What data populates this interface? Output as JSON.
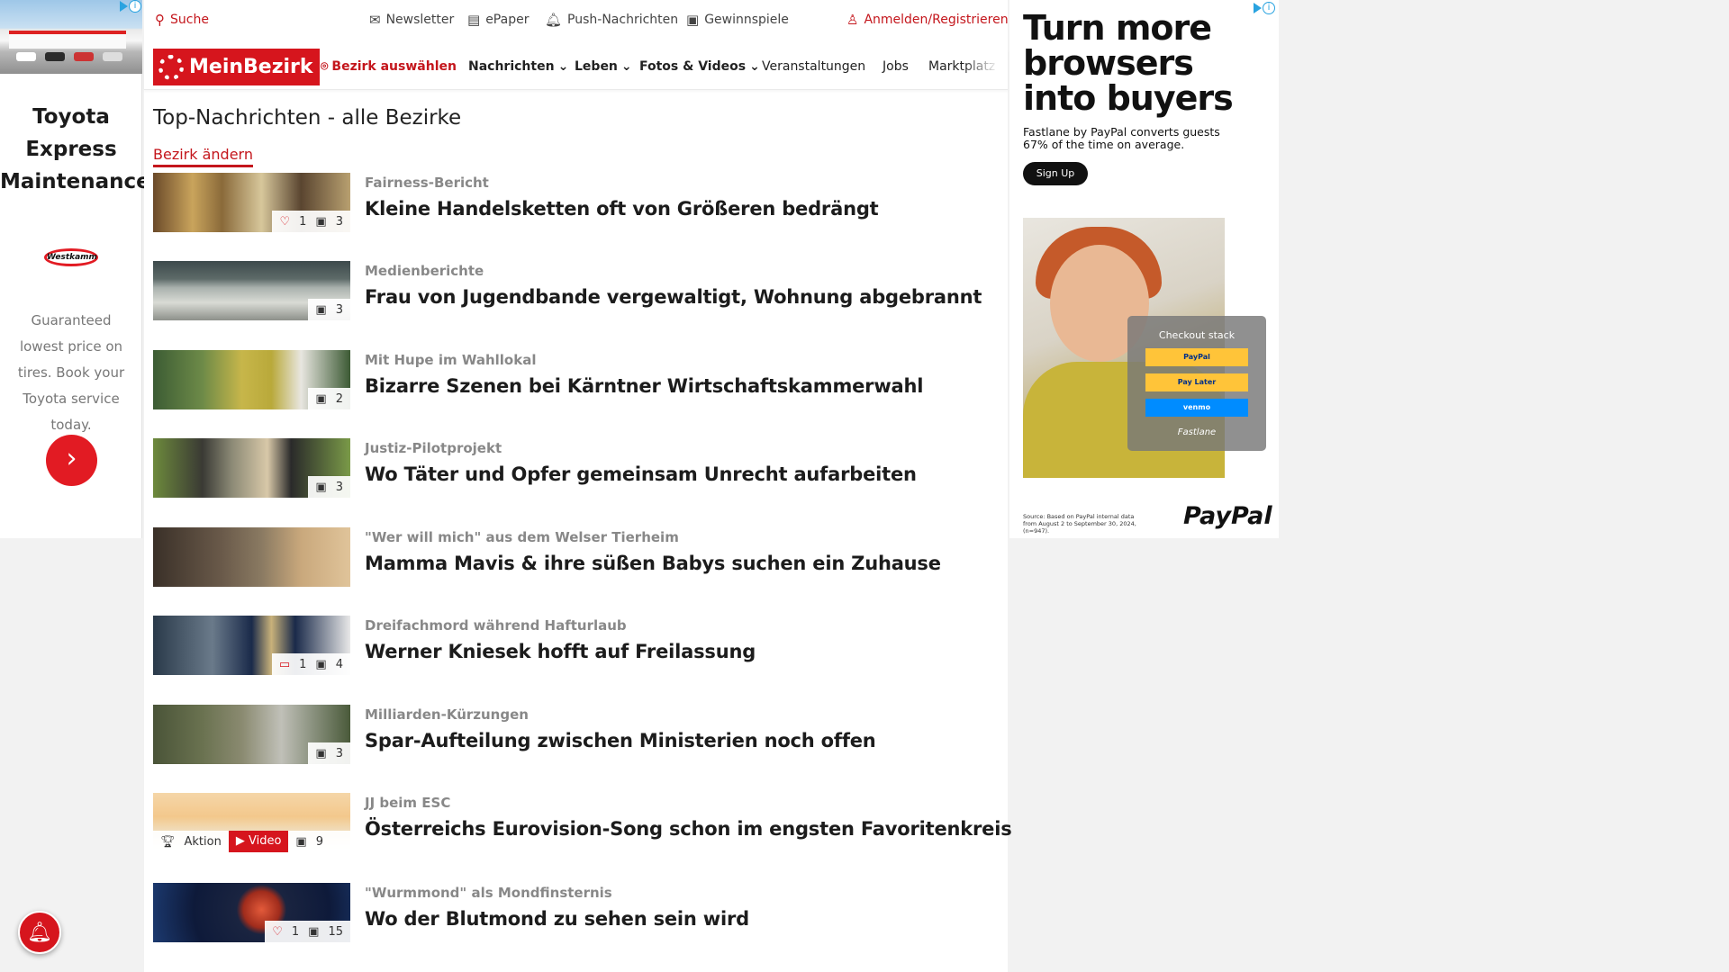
{
  "left_ad": {
    "title": "Toyota Express Maintenance",
    "logo_text": "Westkamm",
    "text": "Guaranteed lowest price on tires. Book your Toyota service today.",
    "cta_icon": "chevron-right-icon"
  },
  "topbar": {
    "search": "Suche",
    "newsletter": "Newsletter",
    "epaper": "ePaper",
    "push": "Push-Nachrichten",
    "games": "Gewinnspiele",
    "login": "Anmelden/Registrieren"
  },
  "nav": {
    "logo": "MeinBezirk",
    "district": "Bezirk auswählen",
    "news": "Nachrichten",
    "life": "Leben",
    "photos": "Fotos & Videos",
    "events": "Veranstaltungen",
    "jobs": "Jobs",
    "market": "Marktplatz"
  },
  "page": {
    "title": "Top-Nachrichten - alle Bezirke",
    "change_district": "Bezirk ändern"
  },
  "news": [
    {
      "kicker": "Fairness-Bericht",
      "headline": "Kleine Handelsketten oft von Größeren bedrängt",
      "likes": "1",
      "images": "3"
    },
    {
      "kicker": "Medienberichte",
      "headline": "Frau von Jugendbande vergewaltigt, Wohnung abgebrannt",
      "likes": "",
      "images": "3"
    },
    {
      "kicker": "Mit Hupe im Wahllokal",
      "headline": "Bizarre Szenen bei Kärntner Wirtschaftskammerwahl",
      "likes": "",
      "images": "2"
    },
    {
      "kicker": "Justiz-Pilotprojekt",
      "headline": "Wo Täter und Opfer gemeinsam Unrecht aufarbeiten",
      "likes": "",
      "images": "3"
    },
    {
      "kicker": "\"Wer will mich\" aus dem Welser Tierheim",
      "headline": "Mamma Mavis & ihre süßen Babys suchen ein Zuhause",
      "likes": "",
      "images": ""
    },
    {
      "kicker": "Dreifachmord während Hafturlaub",
      "headline": "Werner Kniesek hofft auf Freilassung",
      "comments": "1",
      "images": "4"
    },
    {
      "kicker": "Milliarden-Kürzungen",
      "headline": "Spar-Aufteilung zwischen Ministerien noch offen",
      "likes": "",
      "images": "3"
    },
    {
      "kicker": "JJ beim ESC",
      "headline": "Österreichs Eurovision-Song schon im engsten Favoritenkreis",
      "promo": "Aktion",
      "video": "Video",
      "images": "9"
    },
    {
      "kicker": "\"Wurmmond\" als Mondfinsternis",
      "headline": "Wo der Blutmond zu sehen sein wird",
      "likes": "1",
      "images": "15"
    }
  ],
  "right_ad": {
    "headline": "Turn more browsers into buyers",
    "sub": "Fastlane by PayPal converts guests 67% of the time on average.",
    "cta": "Sign Up",
    "checkout_title": "Checkout stack",
    "btn1": "PayPal",
    "btn2": "Pay Later",
    "btn3": "venmo",
    "fastlane": "Fastlane",
    "source": "Source: Based on PayPal internal data from August 2 to September 30, 2024, (n=947).",
    "brand": "PayPal"
  },
  "colors": {
    "brand_red": "#d6151d",
    "link_red": "#c4161c",
    "paypal_yellow": "#ffc439",
    "venmo_blue": "#008cff"
  }
}
